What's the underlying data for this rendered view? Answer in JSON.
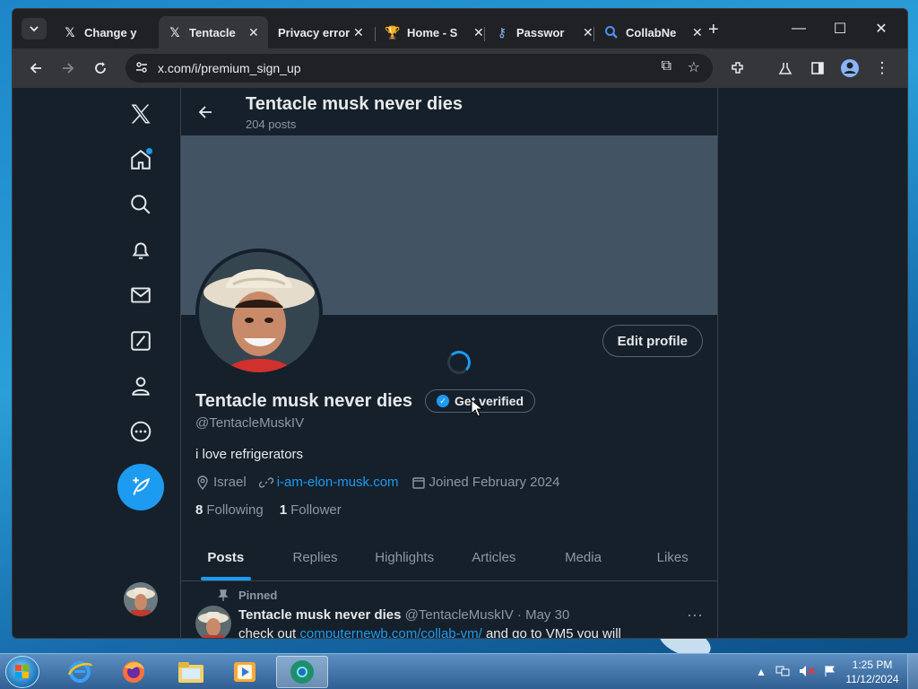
{
  "browser": {
    "tabs": [
      {
        "title": "Change y",
        "icon": "x-logo-icon",
        "active": false
      },
      {
        "title": "Tentacle",
        "icon": "x-logo-icon",
        "active": true
      },
      {
        "title": "Privacy error",
        "icon": "none",
        "active": false
      },
      {
        "title": "Home - S",
        "icon": "trophy-icon",
        "active": false
      },
      {
        "title": "Passwor",
        "icon": "key-icon",
        "active": false
      },
      {
        "title": "CollabNe",
        "icon": "search-icon",
        "active": false
      }
    ],
    "url": "x.com/i/premium_sign_up"
  },
  "profile": {
    "header_name": "Tentacle musk never dies",
    "post_count": "204 posts",
    "display_name": "Tentacle musk never dies",
    "get_verified": "Get verified",
    "edit_profile": "Edit profile",
    "handle": "@TentacleMuskIV",
    "bio": "i love refrigerators",
    "location": "Israel",
    "website": "i-am-elon-musk.com",
    "joined": "Joined February 2024",
    "following_count": "8",
    "following_label": "Following",
    "followers_count": "1",
    "followers_label": "Follower"
  },
  "profile_tabs": [
    "Posts",
    "Replies",
    "Highlights",
    "Articles",
    "Media",
    "Likes"
  ],
  "pinned_tweet": {
    "pinned_label": "Pinned",
    "author": "Tentacle musk never dies",
    "handle_date": "@TentacleMuskIV · May 30",
    "text_prefix": "check out ",
    "text_link": "computernewb.com/collab-vm/",
    "text_suffix": " and go to VM5 you will"
  },
  "taskbar": {
    "time": "1:25 PM",
    "date": "11/12/2024"
  },
  "colors": {
    "accent": "#1d9bf0",
    "background": "#15202b",
    "banner": "#425364"
  }
}
